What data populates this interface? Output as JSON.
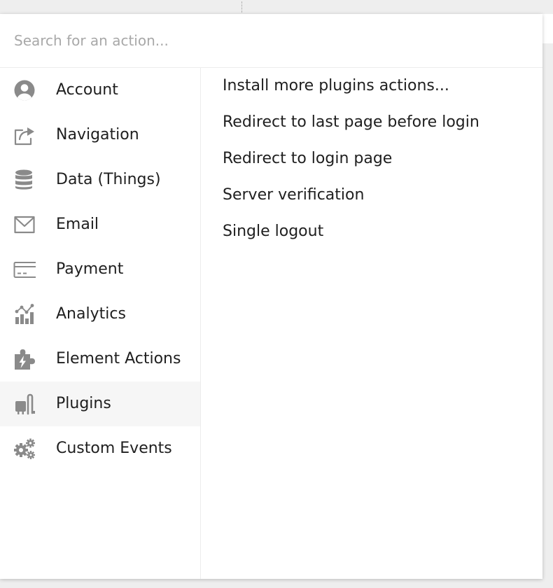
{
  "search": {
    "placeholder": "Search for an action..."
  },
  "categories": [
    {
      "label": "Account",
      "icon": "account-icon"
    },
    {
      "label": "Navigation",
      "icon": "share-icon"
    },
    {
      "label": "Data (Things)",
      "icon": "database-icon"
    },
    {
      "label": "Email",
      "icon": "envelope-icon"
    },
    {
      "label": "Payment",
      "icon": "credit-card-icon"
    },
    {
      "label": "Analytics",
      "icon": "chart-icon"
    },
    {
      "label": "Element Actions",
      "icon": "puzzle-bolt-icon"
    },
    {
      "label": "Plugins",
      "icon": "plug-icon",
      "selected": true
    },
    {
      "label": "Custom Events",
      "icon": "gears-icon"
    }
  ],
  "actions": [
    "Install more plugins actions...",
    "Redirect to last page before login",
    "Redirect to login page",
    "Server verification",
    "Single logout"
  ],
  "colors": {
    "icon": "#8a8a8a",
    "selected_row": "#f6f6f6",
    "text": "#1f1f1f",
    "placeholder": "#a8a8a8"
  }
}
